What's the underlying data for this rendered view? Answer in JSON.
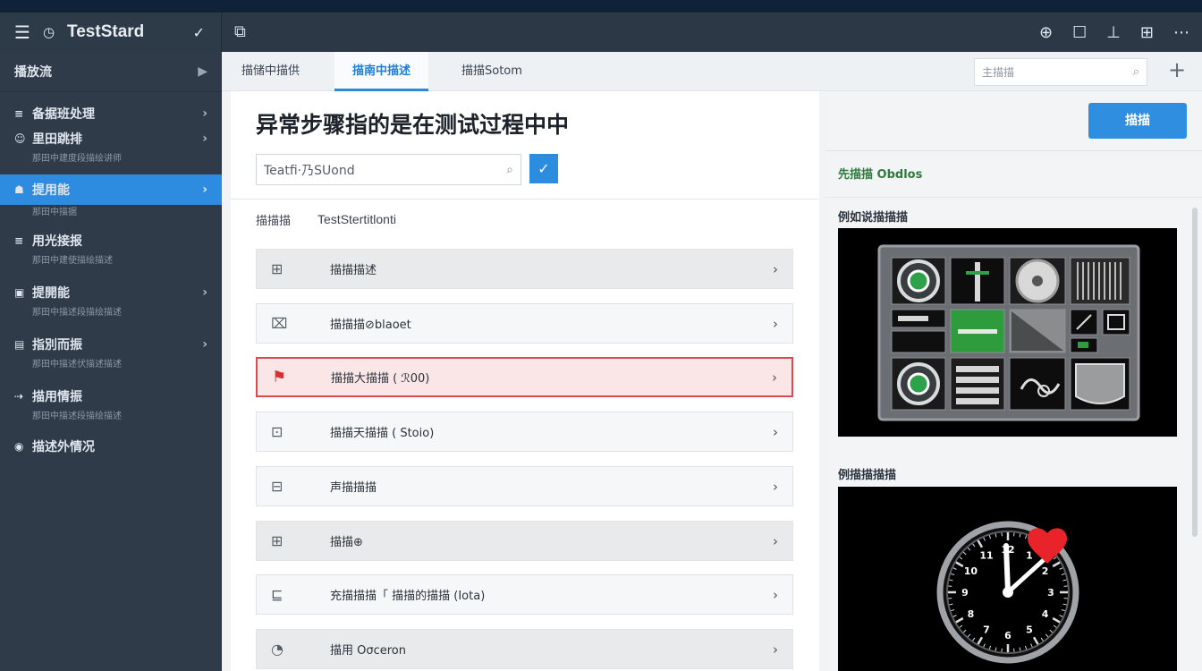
{
  "app": {
    "name": "TestStard"
  },
  "icons": {
    "menu": "hamburger-icon",
    "clock": "clock-icon",
    "check": "check-icon",
    "topbar_right": [
      "compass-icon",
      "square-icon",
      "person-icon",
      "grid-icon",
      "more-icon"
    ]
  },
  "sidebar": {
    "header": "播放流",
    "items": [
      {
        "label": "备据班处理",
        "sub": "",
        "icon": "≡",
        "chevron": true,
        "active": false
      },
      {
        "label": "里田跳排",
        "sub": "那田中建度段描绘讲师",
        "icon": "☺",
        "chevron": true,
        "active": false
      },
      {
        "label": "提用能",
        "sub": "那田中描据",
        "icon": "☗",
        "chevron": true,
        "active": true
      },
      {
        "label": "用光接报",
        "sub": "那田中建使描绘描述",
        "icon": "≡",
        "chevron": false,
        "active": false
      },
      {
        "label": "提開能",
        "sub": "那田中描述段描绘描述",
        "icon": "▣",
        "chevron": true,
        "active": false
      },
      {
        "label": "指別而振",
        "sub": "那田中描述伏描述描述",
        "icon": "▤",
        "chevron": true,
        "active": false
      },
      {
        "label": "描用情振",
        "sub": "那田中描述段描绘描述",
        "icon": "⇢",
        "chevron": false,
        "active": false
      },
      {
        "label": "描述外情况",
        "sub": "",
        "icon": "◉",
        "chevron": false,
        "active": false
      }
    ]
  },
  "tabs": [
    {
      "label": "描储中描供",
      "active": false
    },
    {
      "label": "描南中描述",
      "active": true
    },
    {
      "label": "描描Sotom",
      "active": false
    }
  ],
  "search": {
    "placeholder": "主描描"
  },
  "main": {
    "title": "异常步骤指的是在测试过程中中",
    "input_value": "Teatfi·乃SUond",
    "crumb_label": "描描描",
    "crumb_value": "TestStertitlonti",
    "steps": [
      {
        "label": "描描描述",
        "icon": "⊞",
        "style": "grey"
      },
      {
        "label": "描描描⊘blaoet",
        "icon": "⌧",
        "style": "plain"
      },
      {
        "label": "描描大描描 ( ℛ00)",
        "icon": "⚑",
        "style": "err"
      },
      {
        "label": "描描天描描 ( Stoio)",
        "icon": "⊡",
        "style": "plain"
      },
      {
        "label": "声描描描",
        "icon": "⊟",
        "style": "plain"
      },
      {
        "label": "描描⊕",
        "icon": "⊞",
        "style": "grey"
      },
      {
        "label": "充描描描「 描描的描描 (Iota)",
        "icon": "⊑",
        "style": "plain"
      },
      {
        "label": "描用 Oσceron",
        "icon": "◔",
        "style": "grey"
      }
    ]
  },
  "right": {
    "button": "描描",
    "label1": "先描描 Obdlos",
    "label2": "例如说描描描",
    "label3": "例描描描描"
  },
  "clock": {
    "numbers": [
      "11",
      "12",
      "1",
      "2",
      "3",
      "4",
      "5",
      "6",
      "7",
      "8",
      "9",
      "10"
    ]
  }
}
